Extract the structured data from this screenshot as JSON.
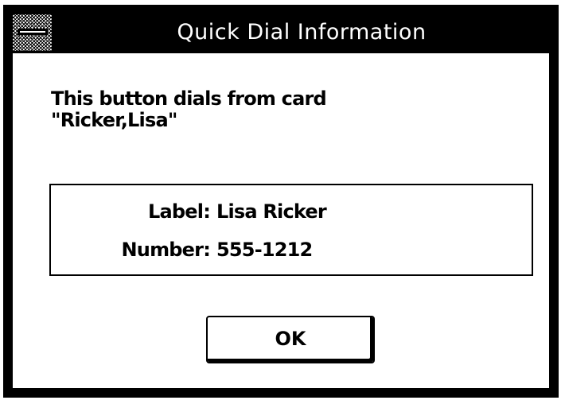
{
  "window": {
    "title": "Quick Dial Information"
  },
  "message": {
    "line1": "This button dials from card",
    "line2": "\"Ricker,Lisa\""
  },
  "info": {
    "label_caption": "Label:",
    "label_value": "Lisa Ricker",
    "number_caption": "Number:",
    "number_value": "555-1212"
  },
  "buttons": {
    "ok_label": "OK"
  },
  "icons": {
    "system_menu": "system-menu-icon"
  },
  "colors": {
    "titlebar": "#000000",
    "title_text": "#ffffff",
    "client": "#ffffff"
  }
}
